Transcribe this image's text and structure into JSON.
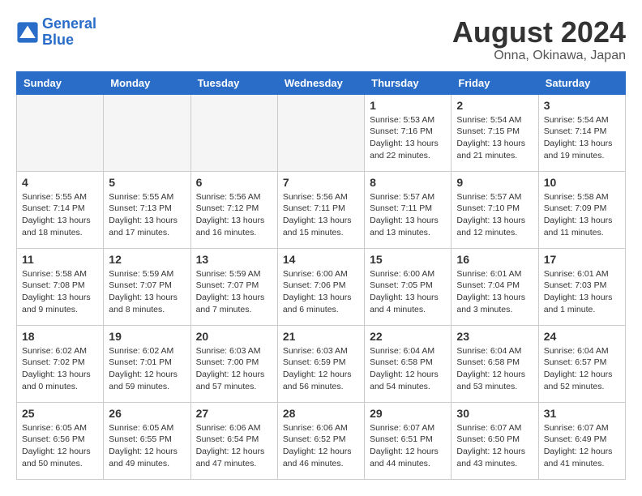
{
  "header": {
    "logo_general": "General",
    "logo_blue": "Blue",
    "month_year": "August 2024",
    "location": "Onna, Okinawa, Japan"
  },
  "weekdays": [
    "Sunday",
    "Monday",
    "Tuesday",
    "Wednesday",
    "Thursday",
    "Friday",
    "Saturday"
  ],
  "weeks": [
    [
      {
        "day": "",
        "sunrise": "",
        "sunset": "",
        "daylight": "",
        "empty": true
      },
      {
        "day": "",
        "sunrise": "",
        "sunset": "",
        "daylight": "",
        "empty": true
      },
      {
        "day": "",
        "sunrise": "",
        "sunset": "",
        "daylight": "",
        "empty": true
      },
      {
        "day": "",
        "sunrise": "",
        "sunset": "",
        "daylight": "",
        "empty": true
      },
      {
        "day": "1",
        "sunrise": "Sunrise: 5:53 AM",
        "sunset": "Sunset: 7:16 PM",
        "daylight": "Daylight: 13 hours and 22 minutes.",
        "empty": false
      },
      {
        "day": "2",
        "sunrise": "Sunrise: 5:54 AM",
        "sunset": "Sunset: 7:15 PM",
        "daylight": "Daylight: 13 hours and 21 minutes.",
        "empty": false
      },
      {
        "day": "3",
        "sunrise": "Sunrise: 5:54 AM",
        "sunset": "Sunset: 7:14 PM",
        "daylight": "Daylight: 13 hours and 19 minutes.",
        "empty": false
      }
    ],
    [
      {
        "day": "4",
        "sunrise": "Sunrise: 5:55 AM",
        "sunset": "Sunset: 7:14 PM",
        "daylight": "Daylight: 13 hours and 18 minutes.",
        "empty": false
      },
      {
        "day": "5",
        "sunrise": "Sunrise: 5:55 AM",
        "sunset": "Sunset: 7:13 PM",
        "daylight": "Daylight: 13 hours and 17 minutes.",
        "empty": false
      },
      {
        "day": "6",
        "sunrise": "Sunrise: 5:56 AM",
        "sunset": "Sunset: 7:12 PM",
        "daylight": "Daylight: 13 hours and 16 minutes.",
        "empty": false
      },
      {
        "day": "7",
        "sunrise": "Sunrise: 5:56 AM",
        "sunset": "Sunset: 7:11 PM",
        "daylight": "Daylight: 13 hours and 15 minutes.",
        "empty": false
      },
      {
        "day": "8",
        "sunrise": "Sunrise: 5:57 AM",
        "sunset": "Sunset: 7:11 PM",
        "daylight": "Daylight: 13 hours and 13 minutes.",
        "empty": false
      },
      {
        "day": "9",
        "sunrise": "Sunrise: 5:57 AM",
        "sunset": "Sunset: 7:10 PM",
        "daylight": "Daylight: 13 hours and 12 minutes.",
        "empty": false
      },
      {
        "day": "10",
        "sunrise": "Sunrise: 5:58 AM",
        "sunset": "Sunset: 7:09 PM",
        "daylight": "Daylight: 13 hours and 11 minutes.",
        "empty": false
      }
    ],
    [
      {
        "day": "11",
        "sunrise": "Sunrise: 5:58 AM",
        "sunset": "Sunset: 7:08 PM",
        "daylight": "Daylight: 13 hours and 9 minutes.",
        "empty": false
      },
      {
        "day": "12",
        "sunrise": "Sunrise: 5:59 AM",
        "sunset": "Sunset: 7:07 PM",
        "daylight": "Daylight: 13 hours and 8 minutes.",
        "empty": false
      },
      {
        "day": "13",
        "sunrise": "Sunrise: 5:59 AM",
        "sunset": "Sunset: 7:07 PM",
        "daylight": "Daylight: 13 hours and 7 minutes.",
        "empty": false
      },
      {
        "day": "14",
        "sunrise": "Sunrise: 6:00 AM",
        "sunset": "Sunset: 7:06 PM",
        "daylight": "Daylight: 13 hours and 6 minutes.",
        "empty": false
      },
      {
        "day": "15",
        "sunrise": "Sunrise: 6:00 AM",
        "sunset": "Sunset: 7:05 PM",
        "daylight": "Daylight: 13 hours and 4 minutes.",
        "empty": false
      },
      {
        "day": "16",
        "sunrise": "Sunrise: 6:01 AM",
        "sunset": "Sunset: 7:04 PM",
        "daylight": "Daylight: 13 hours and 3 minutes.",
        "empty": false
      },
      {
        "day": "17",
        "sunrise": "Sunrise: 6:01 AM",
        "sunset": "Sunset: 7:03 PM",
        "daylight": "Daylight: 13 hours and 1 minute.",
        "empty": false
      }
    ],
    [
      {
        "day": "18",
        "sunrise": "Sunrise: 6:02 AM",
        "sunset": "Sunset: 7:02 PM",
        "daylight": "Daylight: 13 hours and 0 minutes.",
        "empty": false
      },
      {
        "day": "19",
        "sunrise": "Sunrise: 6:02 AM",
        "sunset": "Sunset: 7:01 PM",
        "daylight": "Daylight: 12 hours and 59 minutes.",
        "empty": false
      },
      {
        "day": "20",
        "sunrise": "Sunrise: 6:03 AM",
        "sunset": "Sunset: 7:00 PM",
        "daylight": "Daylight: 12 hours and 57 minutes.",
        "empty": false
      },
      {
        "day": "21",
        "sunrise": "Sunrise: 6:03 AM",
        "sunset": "Sunset: 6:59 PM",
        "daylight": "Daylight: 12 hours and 56 minutes.",
        "empty": false
      },
      {
        "day": "22",
        "sunrise": "Sunrise: 6:04 AM",
        "sunset": "Sunset: 6:58 PM",
        "daylight": "Daylight: 12 hours and 54 minutes.",
        "empty": false
      },
      {
        "day": "23",
        "sunrise": "Sunrise: 6:04 AM",
        "sunset": "Sunset: 6:58 PM",
        "daylight": "Daylight: 12 hours and 53 minutes.",
        "empty": false
      },
      {
        "day": "24",
        "sunrise": "Sunrise: 6:04 AM",
        "sunset": "Sunset: 6:57 PM",
        "daylight": "Daylight: 12 hours and 52 minutes.",
        "empty": false
      }
    ],
    [
      {
        "day": "25",
        "sunrise": "Sunrise: 6:05 AM",
        "sunset": "Sunset: 6:56 PM",
        "daylight": "Daylight: 12 hours and 50 minutes.",
        "empty": false
      },
      {
        "day": "26",
        "sunrise": "Sunrise: 6:05 AM",
        "sunset": "Sunset: 6:55 PM",
        "daylight": "Daylight: 12 hours and 49 minutes.",
        "empty": false
      },
      {
        "day": "27",
        "sunrise": "Sunrise: 6:06 AM",
        "sunset": "Sunset: 6:54 PM",
        "daylight": "Daylight: 12 hours and 47 minutes.",
        "empty": false
      },
      {
        "day": "28",
        "sunrise": "Sunrise: 6:06 AM",
        "sunset": "Sunset: 6:52 PM",
        "daylight": "Daylight: 12 hours and 46 minutes.",
        "empty": false
      },
      {
        "day": "29",
        "sunrise": "Sunrise: 6:07 AM",
        "sunset": "Sunset: 6:51 PM",
        "daylight": "Daylight: 12 hours and 44 minutes.",
        "empty": false
      },
      {
        "day": "30",
        "sunrise": "Sunrise: 6:07 AM",
        "sunset": "Sunset: 6:50 PM",
        "daylight": "Daylight: 12 hours and 43 minutes.",
        "empty": false
      },
      {
        "day": "31",
        "sunrise": "Sunrise: 6:07 AM",
        "sunset": "Sunset: 6:49 PM",
        "daylight": "Daylight: 12 hours and 41 minutes.",
        "empty": false
      }
    ]
  ]
}
